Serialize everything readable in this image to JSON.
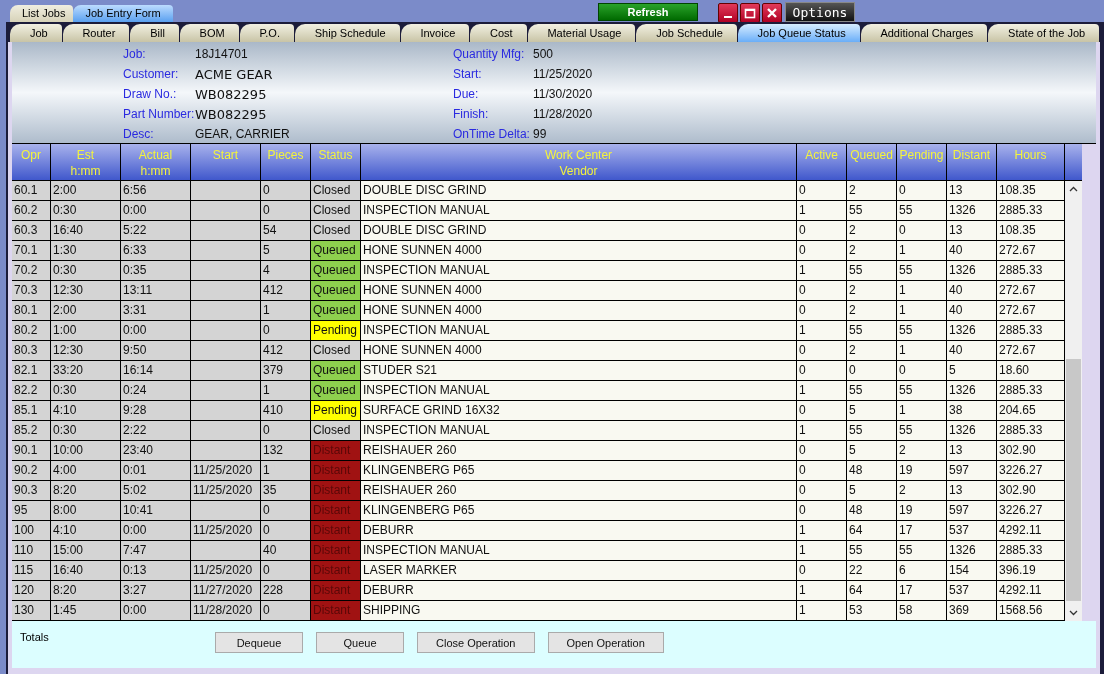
{
  "top_tabs": [
    {
      "label": "List Jobs",
      "selected": false
    },
    {
      "label": "Job Entry Form",
      "selected": true
    }
  ],
  "refresh_button": "Refresh",
  "options_button": "Options",
  "tabs": [
    {
      "label": "Job",
      "selected": false
    },
    {
      "label": "Router",
      "selected": false
    },
    {
      "label": "Bill",
      "selected": false
    },
    {
      "label": "BOM",
      "selected": false
    },
    {
      "label": "P.O.",
      "selected": false
    },
    {
      "label": "Ship Schedule",
      "selected": false
    },
    {
      "label": "Invoice",
      "selected": false
    },
    {
      "label": "Cost",
      "selected": false
    },
    {
      "label": "Material Usage",
      "selected": false
    },
    {
      "label": "Job Schedule",
      "selected": false
    },
    {
      "label": "Job Queue Status",
      "selected": true
    },
    {
      "label": "Additional Charges",
      "selected": false
    },
    {
      "label": "State of the Job",
      "selected": false
    }
  ],
  "job_info": {
    "left": [
      {
        "label": "Job:",
        "value": "18J14701",
        "large": false
      },
      {
        "label": "Customer:",
        "value": "ACME GEAR",
        "large": true
      },
      {
        "label": "Draw No.:",
        "value": "WB082295",
        "large": true
      },
      {
        "label": "Part Number:",
        "value": "WB082295",
        "large": true
      },
      {
        "label": "Desc:",
        "value": "GEAR, CARRIER",
        "large": false
      }
    ],
    "right": [
      {
        "label": "Quantity Mfg:",
        "value": "500",
        "large": false
      },
      {
        "label": "Start:",
        "value": "11/25/2020",
        "large": false
      },
      {
        "label": "Due:",
        "value": "11/30/2020",
        "large": false
      },
      {
        "label": "Finish:",
        "value": "11/28/2020",
        "large": false
      },
      {
        "label": "OnTime Delta:",
        "value": "99",
        "large": false
      }
    ]
  },
  "table": {
    "columns": [
      [
        "Opr"
      ],
      [
        "Est",
        "h:mm"
      ],
      [
        "Actual",
        "h:mm"
      ],
      [
        "Start"
      ],
      [
        "Pieces"
      ],
      [
        "Status"
      ],
      [
        "Work Center",
        "Vendor"
      ],
      [
        "Active"
      ],
      [
        "Queued"
      ],
      [
        "Pending"
      ],
      [
        "Distant"
      ],
      [
        "Hours"
      ]
    ],
    "rows": [
      {
        "opr": "60.1",
        "est": "2:00",
        "actual": "6:56",
        "start": "",
        "pieces": "0",
        "status": "Closed",
        "kind": "closed",
        "work_center": "DOUBLE DISC GRIND",
        "active": "0",
        "queued": "2",
        "pending": "0",
        "distant": "13",
        "hours": "108.35"
      },
      {
        "opr": "60.2",
        "est": "0:30",
        "actual": "0:00",
        "start": "",
        "pieces": "0",
        "status": "Closed",
        "kind": "closed",
        "work_center": "INSPECTION MANUAL",
        "active": "1",
        "queued": "55",
        "pending": "55",
        "distant": "1326",
        "hours": "2885.33"
      },
      {
        "opr": "60.3",
        "est": "16:40",
        "actual": "5:22",
        "start": "",
        "pieces": "54",
        "status": "Closed",
        "kind": "closed",
        "work_center": "DOUBLE DISC GRIND",
        "active": "0",
        "queued": "2",
        "pending": "0",
        "distant": "13",
        "hours": "108.35"
      },
      {
        "opr": "70.1",
        "est": "1:30",
        "actual": "6:33",
        "start": "",
        "pieces": "5",
        "status": "Queued",
        "kind": "queued",
        "work_center": "HONE SUNNEN 4000",
        "active": "0",
        "queued": "2",
        "pending": "1",
        "distant": "40",
        "hours": "272.67"
      },
      {
        "opr": "70.2",
        "est": "0:30",
        "actual": "0:35",
        "start": "",
        "pieces": "4",
        "status": "Queued",
        "kind": "queued",
        "work_center": "INSPECTION MANUAL",
        "active": "1",
        "queued": "55",
        "pending": "55",
        "distant": "1326",
        "hours": "2885.33"
      },
      {
        "opr": "70.3",
        "est": "12:30",
        "actual": "13:11",
        "start": "",
        "pieces": "412",
        "status": "Queued",
        "kind": "queued",
        "work_center": "HONE SUNNEN 4000",
        "active": "0",
        "queued": "2",
        "pending": "1",
        "distant": "40",
        "hours": "272.67"
      },
      {
        "opr": "80.1",
        "est": "2:00",
        "actual": "3:31",
        "start": "",
        "pieces": "1",
        "status": "Queued",
        "kind": "queued",
        "work_center": "HONE SUNNEN 4000",
        "active": "0",
        "queued": "2",
        "pending": "1",
        "distant": "40",
        "hours": "272.67"
      },
      {
        "opr": "80.2",
        "est": "1:00",
        "actual": "0:00",
        "start": "",
        "pieces": "0",
        "status": "Pending",
        "kind": "pending",
        "work_center": "INSPECTION MANUAL",
        "active": "1",
        "queued": "55",
        "pending": "55",
        "distant": "1326",
        "hours": "2885.33"
      },
      {
        "opr": "80.3",
        "est": "12:30",
        "actual": "9:50",
        "start": "",
        "pieces": "412",
        "status": "Closed",
        "kind": "closed",
        "work_center": "HONE SUNNEN 4000",
        "active": "0",
        "queued": "2",
        "pending": "1",
        "distant": "40",
        "hours": "272.67"
      },
      {
        "opr": "82.1",
        "est": "33:20",
        "actual": "16:14",
        "start": "",
        "pieces": "379",
        "status": "Queued",
        "kind": "queued",
        "work_center": "STUDER S21",
        "active": "0",
        "queued": "0",
        "pending": "0",
        "distant": "5",
        "hours": "18.60"
      },
      {
        "opr": "82.2",
        "est": "0:30",
        "actual": "0:24",
        "start": "",
        "pieces": "1",
        "status": "Queued",
        "kind": "queued",
        "work_center": "INSPECTION MANUAL",
        "active": "1",
        "queued": "55",
        "pending": "55",
        "distant": "1326",
        "hours": "2885.33"
      },
      {
        "opr": "85.1",
        "est": "4:10",
        "actual": "9:28",
        "start": "",
        "pieces": "410",
        "status": "Pending",
        "kind": "pending",
        "work_center": "SURFACE GRIND 16X32",
        "active": "0",
        "queued": "5",
        "pending": "1",
        "distant": "38",
        "hours": "204.65"
      },
      {
        "opr": "85.2",
        "est": "0:30",
        "actual": "2:22",
        "start": "",
        "pieces": "0",
        "status": "Closed",
        "kind": "closed",
        "work_center": "INSPECTION MANUAL",
        "active": "1",
        "queued": "55",
        "pending": "55",
        "distant": "1326",
        "hours": "2885.33"
      },
      {
        "opr": "90.1",
        "est": "10:00",
        "actual": "23:40",
        "start": "",
        "pieces": "132",
        "status": "Distant",
        "kind": "distant",
        "work_center": "REISHAUER 260",
        "active": "0",
        "queued": "5",
        "pending": "2",
        "distant": "13",
        "hours": "302.90"
      },
      {
        "opr": "90.2",
        "est": "4:00",
        "actual": "0:01",
        "start": "11/25/2020",
        "pieces": "1",
        "status": "Distant",
        "kind": "distant",
        "work_center": "KLINGENBERG P65",
        "active": "0",
        "queued": "48",
        "pending": "19",
        "distant": "597",
        "hours": "3226.27"
      },
      {
        "opr": "90.3",
        "est": "8:20",
        "actual": "5:02",
        "start": "11/25/2020",
        "pieces": "35",
        "status": "Distant",
        "kind": "distant",
        "work_center": "REISHAUER 260",
        "active": "0",
        "queued": "5",
        "pending": "2",
        "distant": "13",
        "hours": "302.90"
      },
      {
        "opr": "95",
        "est": "8:00",
        "actual": "10:41",
        "start": "",
        "pieces": "0",
        "status": "Distant",
        "kind": "distant",
        "work_center": "KLINGENBERG P65",
        "active": "0",
        "queued": "48",
        "pending": "19",
        "distant": "597",
        "hours": "3226.27"
      },
      {
        "opr": "100",
        "est": "4:10",
        "actual": "0:00",
        "start": "11/25/2020",
        "pieces": "0",
        "status": "Distant",
        "kind": "distant",
        "work_center": "DEBURR",
        "active": "1",
        "queued": "64",
        "pending": "17",
        "distant": "537",
        "hours": "4292.11"
      },
      {
        "opr": "110",
        "est": "15:00",
        "actual": "7:47",
        "start": "",
        "pieces": "40",
        "status": "Distant",
        "kind": "distant",
        "work_center": "INSPECTION MANUAL",
        "active": "1",
        "queued": "55",
        "pending": "55",
        "distant": "1326",
        "hours": "2885.33"
      },
      {
        "opr": "115",
        "est": "16:40",
        "actual": "0:13",
        "start": "11/25/2020",
        "pieces": "0",
        "status": "Distant",
        "kind": "distant",
        "work_center": "LASER MARKER",
        "active": "0",
        "queued": "22",
        "pending": "6",
        "distant": "154",
        "hours": "396.19"
      },
      {
        "opr": "120",
        "est": "8:20",
        "actual": "3:27",
        "start": "11/27/2020",
        "pieces": "228",
        "status": "Distant",
        "kind": "distant",
        "work_center": "DEBURR",
        "active": "1",
        "queued": "64",
        "pending": "17",
        "distant": "537",
        "hours": "4292.11"
      },
      {
        "opr": "130",
        "est": "1:45",
        "actual": "0:00",
        "start": "11/28/2020",
        "pieces": "0",
        "status": "Distant",
        "kind": "distant",
        "work_center": "SHIPPING",
        "active": "1",
        "queued": "53",
        "pending": "58",
        "distant": "369",
        "hours": "1568.56"
      }
    ]
  },
  "totals_label": "Totals",
  "buttons": [
    "Dequeue",
    "Queue",
    "Close Operation",
    "Open Operation"
  ]
}
